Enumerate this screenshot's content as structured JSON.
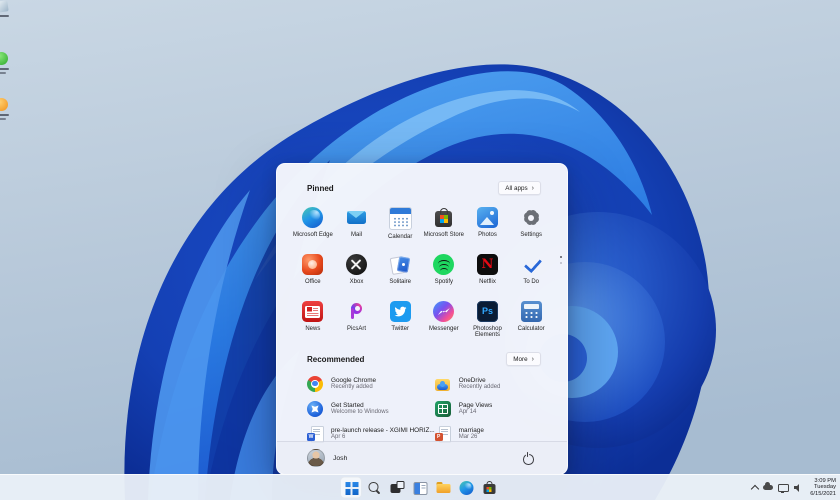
{
  "desktop": {
    "icons": [
      {
        "name": "desktop-shortcut-1"
      },
      {
        "name": "desktop-shortcut-2"
      },
      {
        "name": "desktop-shortcut-3"
      }
    ],
    "wallpaper": {
      "sky": "#b8c9da",
      "bloom_dark": "#0c2e96",
      "bloom_bright": "#56a8f2"
    }
  },
  "start_menu": {
    "pinned": {
      "header": "Pinned",
      "all_apps_label": "All apps",
      "chevron": "›",
      "apps": [
        {
          "name": "Microsoft Edge",
          "icon": "edge-icon"
        },
        {
          "name": "Mail",
          "icon": "mail-icon"
        },
        {
          "name": "Calendar",
          "icon": "calendar-icon"
        },
        {
          "name": "Microsoft Store",
          "icon": "microsoft-store-icon"
        },
        {
          "name": "Photos",
          "icon": "photos-icon"
        },
        {
          "name": "Settings",
          "icon": "settings-gear-icon"
        },
        {
          "name": "Office",
          "icon": "office-icon"
        },
        {
          "name": "Xbox",
          "icon": "xbox-icon"
        },
        {
          "name": "Solitaire",
          "icon": "solitaire-icon"
        },
        {
          "name": "Spotify",
          "icon": "spotify-icon"
        },
        {
          "name": "Netflix",
          "icon": "netflix-icon"
        },
        {
          "name": "To Do",
          "icon": "todo-check-icon"
        },
        {
          "name": "News",
          "icon": "news-icon"
        },
        {
          "name": "PicsArt",
          "icon": "picsart-icon"
        },
        {
          "name": "Twitter",
          "icon": "twitter-bird-icon"
        },
        {
          "name": "Messenger",
          "icon": "messenger-icon"
        },
        {
          "name": "Photoshop Elements",
          "icon": "photoshop-elements-icon"
        },
        {
          "name": "Calculator",
          "icon": "calculator-icon"
        }
      ]
    },
    "recommended": {
      "header": "Recommended",
      "more_label": "More",
      "chevron": "›",
      "items": [
        {
          "title": "Google Chrome",
          "subtitle": "Recently added",
          "icon": "chrome-icon"
        },
        {
          "title": "OneDrive",
          "subtitle": "Recently added",
          "icon": "onedrive-folder-icon"
        },
        {
          "title": "Get Started",
          "subtitle": "Welcome to Windows",
          "icon": "get-started-icon"
        },
        {
          "title": "Page Views",
          "subtitle": "Apr 14",
          "icon": "excel-file-icon"
        },
        {
          "title": "pre-launch release - XGIMI HORIZ...",
          "subtitle": "Apr 6",
          "icon": "word-file-icon"
        },
        {
          "title": "marriage",
          "subtitle": "Mar 26",
          "icon": "powerpoint-file-icon"
        }
      ]
    },
    "user": {
      "name": "Josh"
    }
  },
  "taskbar": {
    "buttons": [
      "start",
      "search",
      "task-view",
      "widgets",
      "file-explorer",
      "edge",
      "store"
    ],
    "tray": {
      "time": "3:09 PM",
      "day": "Tuesday",
      "date": "6/15/2021"
    }
  }
}
